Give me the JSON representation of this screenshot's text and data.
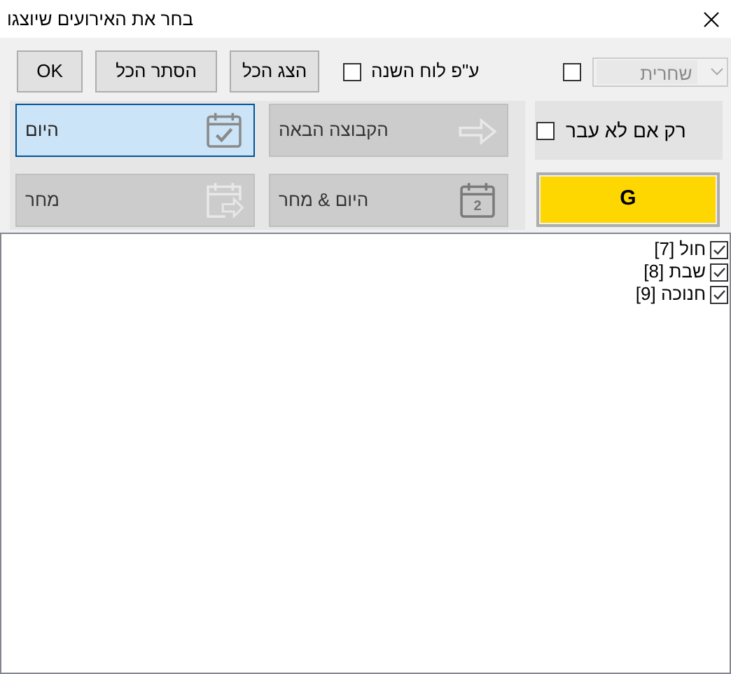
{
  "window": {
    "title": "בחר את האירועים שיוצגו"
  },
  "toolbar": {
    "buttons": [
      "הצג הכל",
      "הסתר הכל",
      "OK"
    ],
    "calendar_option": {
      "label": "ע\"פ לוח השנה",
      "checked": false
    },
    "prayer_option": {
      "checked": false
    },
    "prayer_select": {
      "value": "שחרית",
      "disabled": true
    }
  },
  "tiles": [
    {
      "label": "הקבוצה הבאה",
      "kind": "arrow",
      "selected": false
    },
    {
      "label": "היום",
      "kind": "check",
      "selected": true
    },
    {
      "label": "היום & מחר",
      "kind": "numbered",
      "number": "2",
      "selected": false
    },
    {
      "label": "מחר",
      "kind": "forward",
      "selected": false
    }
  ],
  "only_if_not_passed": {
    "label": "רק אם לא עבר",
    "checked": false
  },
  "g_button": {
    "label": "G"
  },
  "events": [
    {
      "label": "חול [7]",
      "checked": true
    },
    {
      "label": "שבת [8]",
      "checked": true
    },
    {
      "label": "חנוכה [9]",
      "checked": true
    }
  ]
}
